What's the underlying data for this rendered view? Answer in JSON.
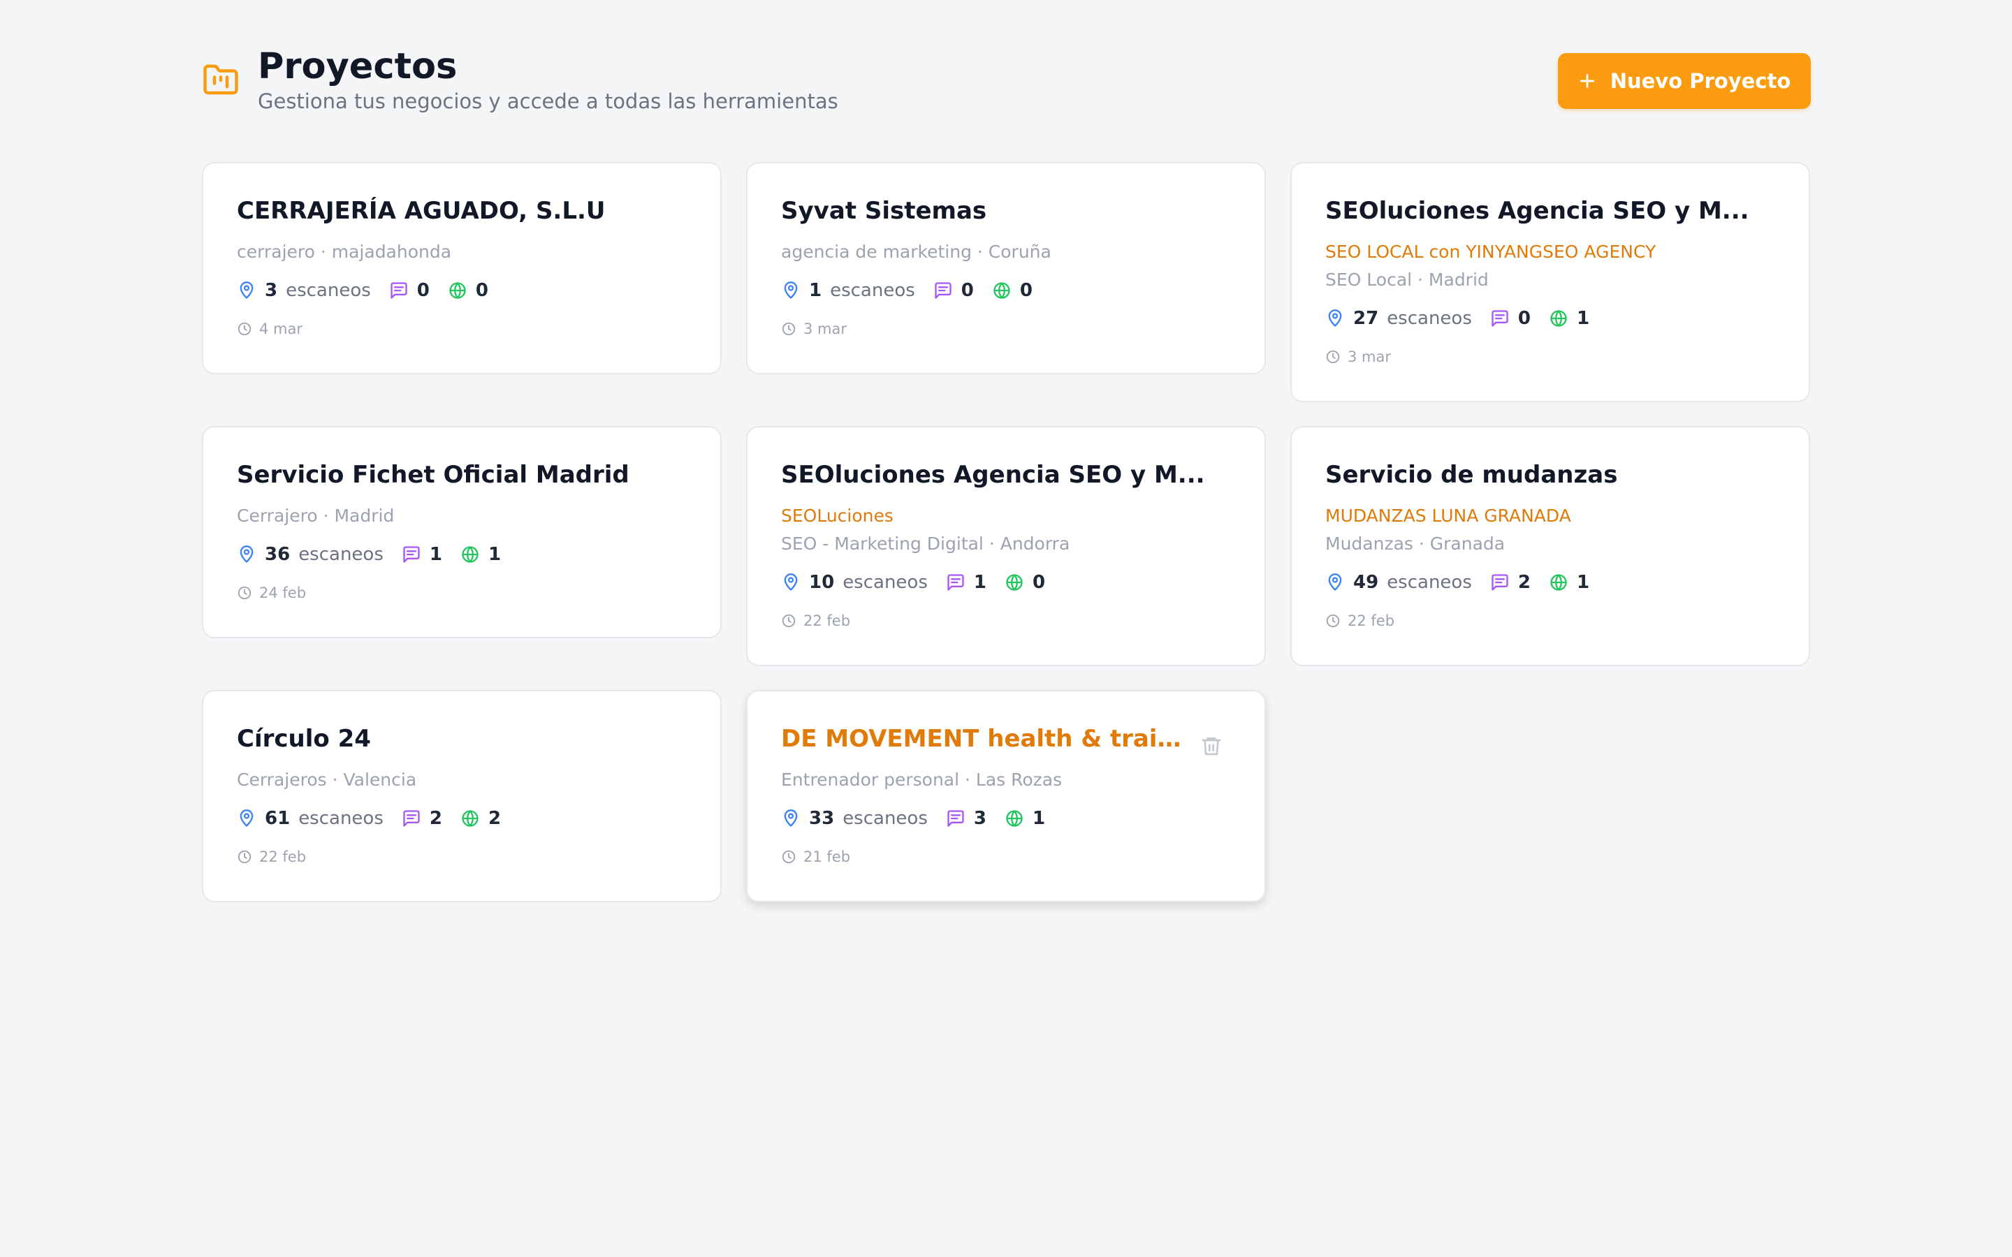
{
  "header": {
    "title": "Proyectos",
    "subtitle": "Gestiona tus negocios y accede a todas las herramientas",
    "new_button_label": "Nuevo Proyecto",
    "icon": "folder-kanban-icon"
  },
  "colors": {
    "accent": "#fb9b0f",
    "accent_text": "#e07b0a",
    "scan_icon": "#3b82f6",
    "review_icon": "#a855f7",
    "web_icon": "#22c55e"
  },
  "labels": {
    "scans": "escaneos"
  },
  "projects": [
    {
      "title": "CERRAJERÍA AGUADO, S.L.U",
      "client": "",
      "meta": "cerrajero · majadahonda",
      "scans": "3",
      "reviews": "0",
      "webs": "0",
      "date": "4 mar"
    },
    {
      "title": "Syvat Sistemas",
      "client": "",
      "meta": "agencia de marketing · Coruña",
      "scans": "1",
      "reviews": "0",
      "webs": "0",
      "date": "3 mar"
    },
    {
      "title": "SEOluciones Agencia SEO y M...",
      "client": "SEO LOCAL con YINYANGSEO AGENCY",
      "meta": "SEO Local · Madrid",
      "scans": "27",
      "reviews": "0",
      "webs": "1",
      "date": "3 mar"
    },
    {
      "title": "Servicio Fichet Oficial Madrid",
      "client": "",
      "meta": "Cerrajero · Madrid",
      "scans": "36",
      "reviews": "1",
      "webs": "1",
      "date": "24 feb"
    },
    {
      "title": "SEOluciones Agencia SEO y M...",
      "client": "SEOLuciones",
      "meta": "SEO - Marketing Digital · Andorra",
      "scans": "10",
      "reviews": "1",
      "webs": "0",
      "date": "22 feb"
    },
    {
      "title": "Servicio de mudanzas",
      "client": "MUDANZAS LUNA GRANADA",
      "meta": "Mudanzas · Granada",
      "scans": "49",
      "reviews": "2",
      "webs": "1",
      "date": "22 feb"
    },
    {
      "title": "Círculo 24",
      "client": "",
      "meta": "Cerrajeros · Valencia",
      "scans": "61",
      "reviews": "2",
      "webs": "2",
      "date": "22 feb"
    },
    {
      "title": "DE MOVEMENT health & traini...",
      "client": "",
      "meta": "Entrenador personal · Las Rozas",
      "scans": "33",
      "reviews": "3",
      "webs": "1",
      "date": "21 feb",
      "hovered": true
    }
  ]
}
